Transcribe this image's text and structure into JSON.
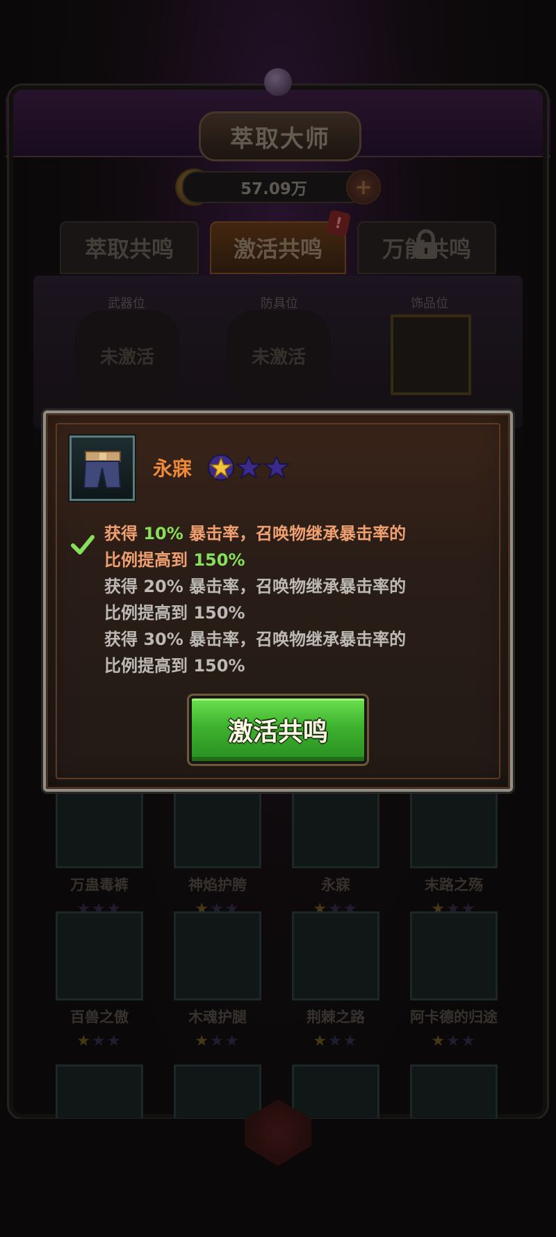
{
  "header": {
    "title": "萃取大师",
    "currency_value": "57.09万",
    "plus_label": "+"
  },
  "tabs": [
    {
      "label": "萃取共鸣"
    },
    {
      "label": "激活共鸣"
    },
    {
      "label": "万能共鸣"
    }
  ],
  "tab_badge": "!",
  "slots": [
    {
      "label": "武器位",
      "state": "未激活"
    },
    {
      "label": "防具位",
      "state": "未激活"
    },
    {
      "label": "饰品位",
      "state": ""
    }
  ],
  "grid_items": [
    {
      "name": "万蛊毒裤",
      "stars_gold": 0,
      "stars_total": 3
    },
    {
      "name": "神焰护胯",
      "stars_gold": 1,
      "stars_total": 3
    },
    {
      "name": "永寐",
      "stars_gold": 1,
      "stars_total": 3
    },
    {
      "name": "末路之殇",
      "stars_gold": 1,
      "stars_total": 3
    },
    {
      "name": "百兽之傲",
      "stars_gold": 1,
      "stars_total": 3
    },
    {
      "name": "木魂护腿",
      "stars_gold": 1,
      "stars_total": 3
    },
    {
      "name": "荆棘之路",
      "stars_gold": 1,
      "stars_total": 3
    },
    {
      "name": "阿卡德的归途",
      "stars_gold": 1,
      "stars_total": 3
    }
  ],
  "modal": {
    "item_name": "永寐",
    "stars_gold": 1,
    "stars_total": 3,
    "effects": [
      {
        "prefix": "获得 ",
        "pct": "10%",
        "mid": " 暴击率，召唤物继承暴击率的",
        "line2": "比例提高到 ",
        "pct2": "150%",
        "active": true
      },
      {
        "prefix": "获得 ",
        "pct": "20%",
        "mid": " 暴击率，召唤物继承暴击率的",
        "line2": "比例提高到 ",
        "pct2": "150%",
        "active": false
      },
      {
        "prefix": "获得 ",
        "pct": "30%",
        "mid": " 暴击率，召唤物继承暴击率的",
        "line2": "比例提高到 ",
        "pct2": "150%",
        "active": false
      }
    ],
    "button_label": "激活共鸣"
  },
  "colors": {
    "accent_orange": "#ef8a3a",
    "active_green": "#86e05a",
    "button_green": "#3db22e",
    "star_gold": "#e8b52a",
    "star_purple": "#3a2b8a"
  },
  "icons": [
    "coin-icon",
    "plus-icon",
    "lock-icon",
    "check-icon",
    "star-icon",
    "pants-icon"
  ]
}
